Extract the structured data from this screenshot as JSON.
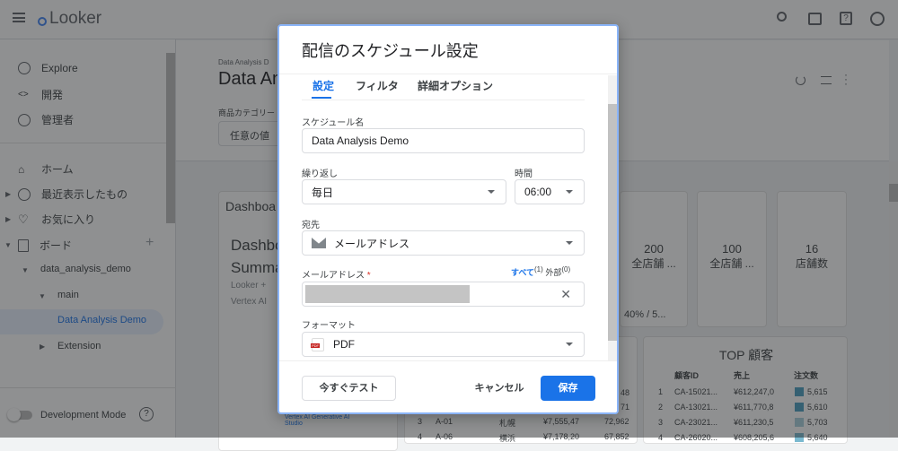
{
  "header": {
    "logo": "Looker",
    "icons": [
      "search-icon",
      "marketplace-icon",
      "help-icon",
      "account-icon"
    ]
  },
  "sidebar": {
    "items": [
      {
        "label": "Explore",
        "icon": "compass-icon"
      },
      {
        "label": "開発",
        "icon": "code-icon"
      },
      {
        "label": "管理者",
        "icon": "admin-icon"
      },
      {
        "label": "ホーム",
        "icon": "home-icon"
      },
      {
        "label": "最近表示したもの",
        "icon": "clock-icon"
      },
      {
        "label": "お気に入り",
        "icon": "heart-icon"
      },
      {
        "label": "ボード",
        "icon": "board-icon"
      }
    ],
    "tree": {
      "folder": "data_analysis_demo",
      "sub": "main",
      "active": "Data Analysis Demo",
      "other": "Extension"
    },
    "dev_mode": "Development Mode"
  },
  "dashboard": {
    "breadcrumb": "Data Analysis D",
    "title": "Data An",
    "filter_label": "商品カテゴリー",
    "filter_value": "任意の値",
    "card_title": "Dashboa",
    "summary_1": "Dashbo",
    "summary_2": "Summa",
    "sub_1": "Looker +",
    "sub_2": "Vertex AI",
    "link": "Vertex AI Generative AI Studio",
    "tiles": [
      {
        "value": "200",
        "label": "全店舗 ..."
      },
      {
        "value": "100",
        "label": "全店舗 ..."
      },
      {
        "value": "16",
        "label": "店舗数"
      }
    ],
    "progress": "40% / 5...",
    "top_title": "TOP 顧客",
    "top_headers": [
      "顧客ID",
      "売上",
      "注文数"
    ],
    "top_rows": [
      [
        "1",
        "CA-15021...",
        "¥612,247,0",
        "5,615"
      ],
      [
        "2",
        "CA-13021...",
        "¥611,770,8",
        "5,610"
      ],
      [
        "3",
        "CA-23021...",
        "¥611,230,5",
        "5,703"
      ],
      [
        "4",
        "CA-26020...",
        "¥608,205,6",
        "5,640"
      ]
    ],
    "store_rows": [
      [
        "3",
        "A-01",
        "札幌",
        "¥7,555,47",
        "72,962"
      ],
      [
        "4",
        "A-06",
        "横浜",
        "¥7,178,20",
        "67,852"
      ]
    ],
    "partial": [
      "48",
      "71"
    ]
  },
  "modal": {
    "title": "配信のスケジュール設定",
    "tabs": [
      "設定",
      "フィルタ",
      "詳細オプション"
    ],
    "name_label": "スケジュール名",
    "name_value": "Data Analysis Demo",
    "repeat_label": "繰り返し",
    "repeat_value": "毎日",
    "time_label": "時間",
    "time_value": "06:00",
    "dest_label": "宛先",
    "dest_value": "メールアドレス",
    "email_label": "メールアドレス",
    "required": "*",
    "all_label": "すべて",
    "all_count": "(1)",
    "ext_label": "外部",
    "ext_count": "(0)",
    "format_label": "フォーマット",
    "format_value": "PDF",
    "pdf_badge": "PDF",
    "test_button": "今すぐテスト",
    "cancel_button": "キャンセル",
    "save_button": "保存"
  },
  "colors": {
    "accent": "#1a73e8"
  }
}
